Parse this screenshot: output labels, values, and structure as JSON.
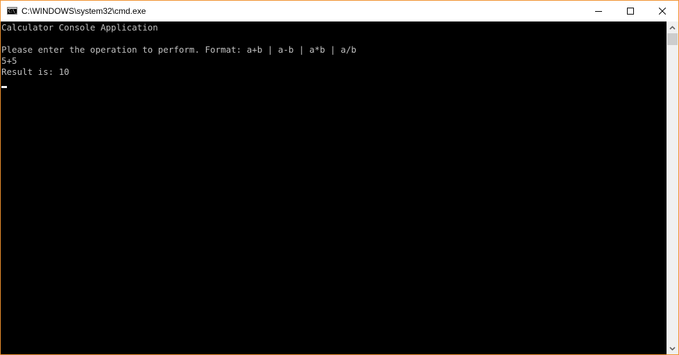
{
  "window": {
    "title": "C:\\WINDOWS\\system32\\cmd.exe",
    "icon": "cmd-icon",
    "icon_text": "C:\\_",
    "border_color": "#f0922e",
    "controls": [
      "minimize-icon",
      "maximize-icon",
      "close-icon"
    ]
  },
  "console": {
    "lines": [
      "Calculator Console Application",
      "",
      "Please enter the operation to perform. Format: a+b | a-b | a*b | a/b",
      "5+5",
      "Result is: 10"
    ],
    "text_color": "#c0c0c0",
    "background": "#000000"
  },
  "scrollbar": {
    "up": "chevron-up-icon",
    "down": "chevron-down-icon"
  }
}
